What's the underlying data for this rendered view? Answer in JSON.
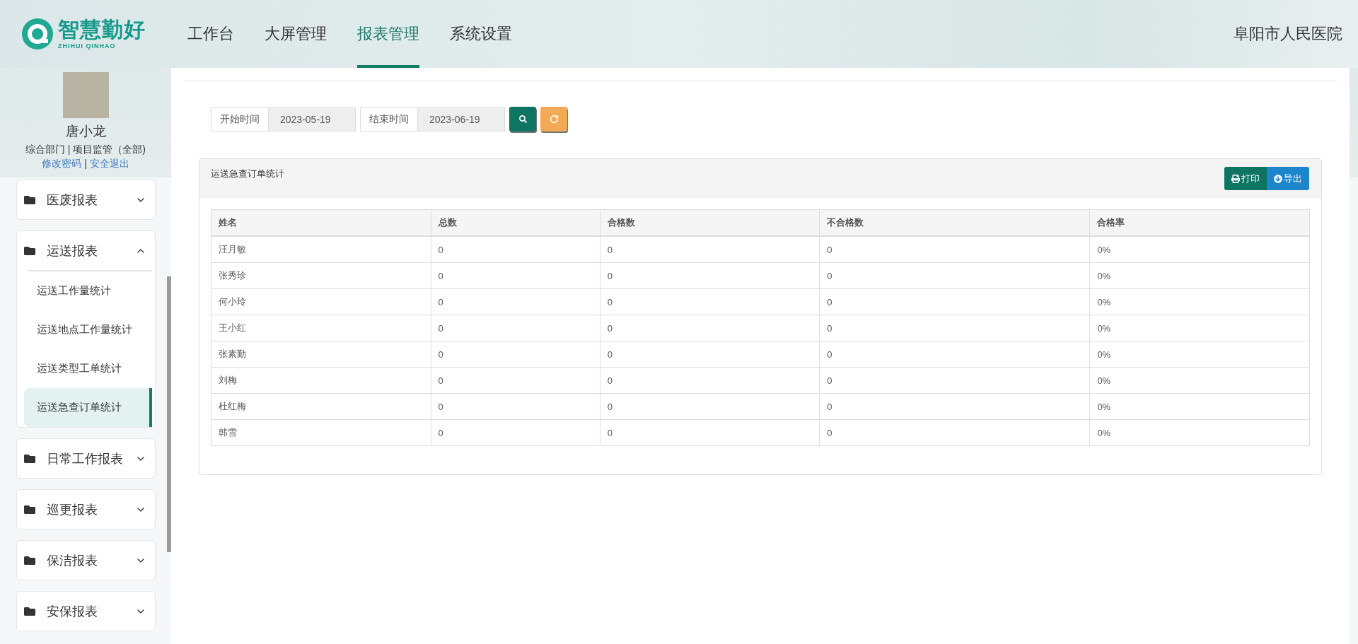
{
  "header": {
    "logo": {
      "title": "智慧勤好",
      "subtitle": "ZHIHUI QINHAO"
    },
    "nav": [
      {
        "label": "工作台",
        "selected": false
      },
      {
        "label": "大屏管理",
        "selected": false
      },
      {
        "label": "报表管理",
        "selected": true
      },
      {
        "label": "系统设置",
        "selected": false
      }
    ],
    "organization": "阜阳市人民医院"
  },
  "user": {
    "name": "唐小龙",
    "department": "综合部门 | 项目监管（全部)",
    "links": [
      "修改密码",
      "安全退出"
    ],
    "link_separator": "|"
  },
  "sidebar": {
    "items": [
      {
        "label": "医废报表",
        "expanded": false
      },
      {
        "label": "运送报表",
        "expanded": true,
        "children": [
          {
            "label": "运送工作量统计",
            "selected": false
          },
          {
            "label": "运送地点工作量统计",
            "selected": false
          },
          {
            "label": "运送类型工单统计",
            "selected": false
          },
          {
            "label": "运送急查订单统计",
            "selected": true
          }
        ]
      },
      {
        "label": "日常工作报表",
        "expanded": false
      },
      {
        "label": "巡更报表",
        "expanded": false
      },
      {
        "label": "保洁报表",
        "expanded": false
      },
      {
        "label": "安保报表",
        "expanded": false
      }
    ]
  },
  "filters": [
    {
      "label": "开始时间",
      "value": "2023-05-19"
    },
    {
      "label": "结束时间",
      "value": "2023-06-19"
    }
  ],
  "panel": {
    "title": "运送急查订单统计",
    "buttons": [
      {
        "kind": "print",
        "label": "打印"
      },
      {
        "kind": "export",
        "label": "导出"
      }
    ]
  },
  "table": {
    "columns": [
      "姓名",
      "总数",
      "合格数",
      "不合格数",
      "合格率"
    ],
    "rows": [
      [
        "汪月敏",
        "0",
        "0",
        "0",
        "0%"
      ],
      [
        "张秀珍",
        "0",
        "0",
        "0",
        "0%"
      ],
      [
        "何小玲",
        "0",
        "0",
        "0",
        "0%"
      ],
      [
        "王小红",
        "0",
        "0",
        "0",
        "0%"
      ],
      [
        "张素勤",
        "0",
        "0",
        "0",
        "0%"
      ],
      [
        "刘梅",
        "0",
        "0",
        "0",
        "0%"
      ],
      [
        "杜红梅",
        "0",
        "0",
        "0",
        "0%"
      ],
      [
        "韩雪",
        "0",
        "0",
        "0",
        "0%"
      ]
    ]
  }
}
